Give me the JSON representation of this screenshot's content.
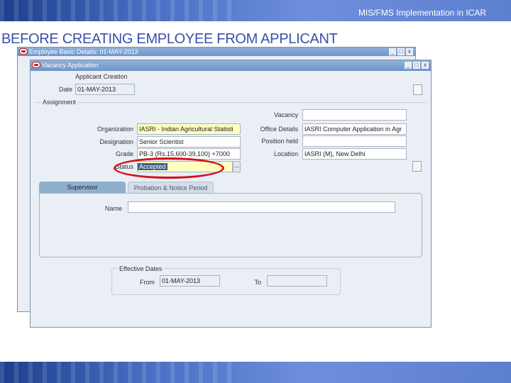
{
  "header": {
    "title": "MIS/FMS Implementation in ICAR"
  },
  "slide": {
    "title": "BEFORE CREATING EMPLOYEE FROM APPLICANT"
  },
  "back_window": {
    "title": "Employee Basic Details: 01-MAY-2013",
    "window_buttons": [
      "_",
      "□",
      "x"
    ]
  },
  "front_window": {
    "title": "Vacancy Application",
    "window_buttons": [
      "_",
      "□",
      "x"
    ]
  },
  "form": {
    "section_label": "Applicant Creation",
    "date_label": "Date",
    "date_value": "01-MAY-2013",
    "assignment_label": "Assignment",
    "organization_label": "Organization",
    "organization_value": "IASRI - Indian Agricultural Statisti",
    "designation_label": "Designation",
    "designation_value": "Senior Scientist",
    "grade_label": "Grade",
    "grade_value": "PB-3 (Rs.15,600-39,100) +7000",
    "status_label": "Status",
    "status_value": "Accepted",
    "lov_label": "...",
    "vacancy_label": "Vacancy",
    "vacancy_value": "",
    "office_label": "Office Details",
    "office_value": "IASRI Computer Application in Agr",
    "position_label": "Position held",
    "position_value": "",
    "location_label": "Location",
    "location_value": "IASRI (M), New Delhi"
  },
  "tabs": [
    {
      "label": "Supervisor",
      "active": true
    },
    {
      "label": "Probation & Notice Period",
      "active": false
    }
  ],
  "supervisor": {
    "name_label": "Name",
    "name_value": ""
  },
  "effective": {
    "label": "Effective Dates",
    "from_label": "From",
    "from_value": "01-MAY-2013",
    "to_label": "To",
    "to_value": ""
  },
  "colors": {
    "highlight": "#d0101a",
    "required": "#ffffc0"
  }
}
